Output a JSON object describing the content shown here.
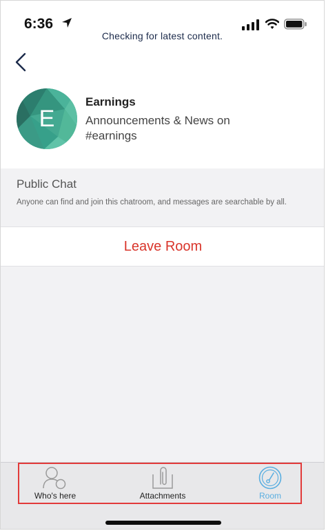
{
  "status_bar": {
    "time": "6:36",
    "message": "Checking for latest content."
  },
  "room": {
    "avatar_letter": "E",
    "title": "Earnings",
    "description": "Announcements & News on #earnings"
  },
  "privacy": {
    "title": "Public Chat",
    "description": "Anyone can find and join this chatroom, and messages are searchable by all."
  },
  "actions": {
    "leave_label": "Leave Room"
  },
  "tabs": [
    {
      "label": "Who's here",
      "icon": "people-icon",
      "active": false
    },
    {
      "label": "Attachments",
      "icon": "paperclip-icon",
      "active": false
    },
    {
      "label": "Room",
      "icon": "gauge-icon",
      "active": true
    }
  ],
  "colors": {
    "accent_red": "#d9352b",
    "active_tab": "#5aaee0",
    "inactive_tab": "#999999",
    "avatar_green": "#3aa28b"
  }
}
